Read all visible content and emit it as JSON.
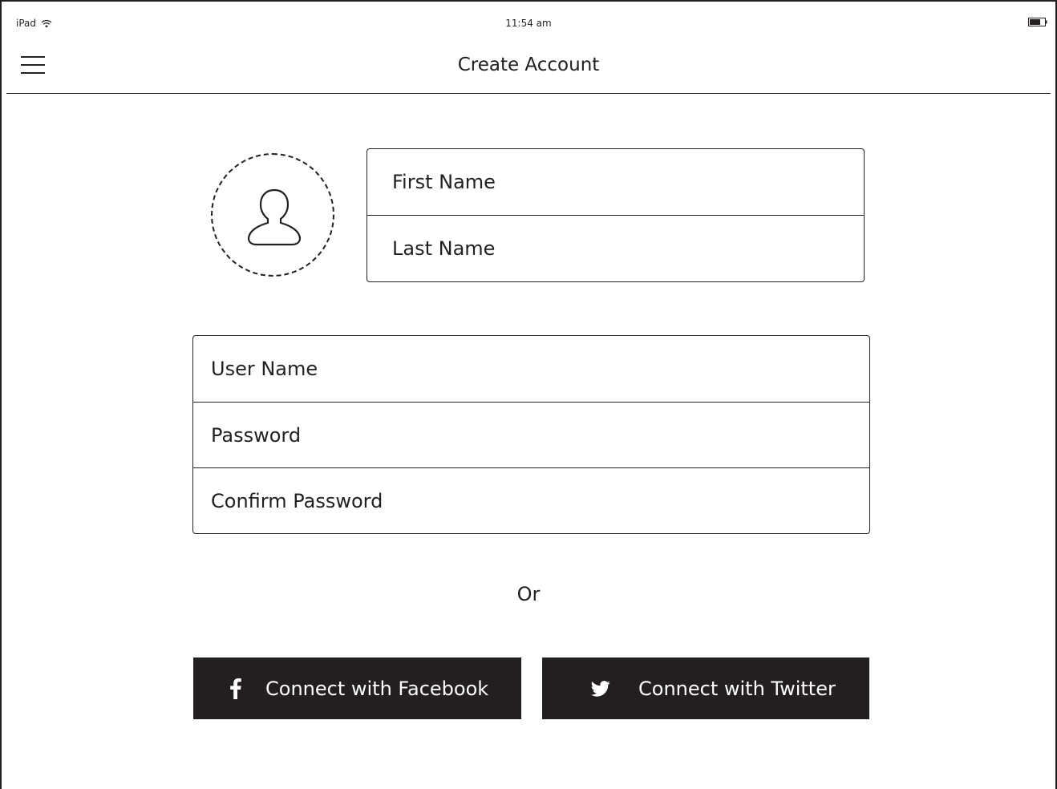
{
  "status_bar": {
    "device": "iPad",
    "time": "11:54 am",
    "wifi_icon": "wifi-icon",
    "battery_icon": "battery-icon"
  },
  "nav": {
    "title": "Create Account",
    "menu_icon": "hamburger-menu-icon"
  },
  "avatar": {
    "icon": "user-silhouette-icon"
  },
  "name_fields": {
    "first_name_placeholder": "First Name",
    "last_name_placeholder": "Last Name"
  },
  "credential_fields": {
    "username_placeholder": "User Name",
    "password_placeholder": "Password",
    "confirm_password_placeholder": "Confirm Password"
  },
  "divider_text": "Or",
  "social": {
    "facebook_label": "Connect with Facebook",
    "facebook_icon": "facebook-icon",
    "twitter_label": "Connect with  Twitter",
    "twitter_icon": "twitter-icon"
  },
  "colors": {
    "ink": "#231f20",
    "background": "#ffffff",
    "button_text": "#ffffff"
  }
}
